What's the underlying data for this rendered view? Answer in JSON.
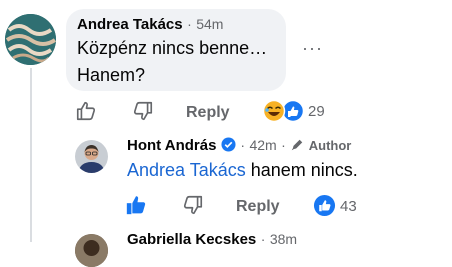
{
  "comment1": {
    "author": "Andrea Takács",
    "time": "54m",
    "separator": "·",
    "line1": "Közpénz nincs benne…",
    "line2": "Hanem?",
    "more": "···",
    "reply_label": "Reply",
    "reaction_count": "29"
  },
  "comment2": {
    "author": "Hont András",
    "separator": "·",
    "time": "42m",
    "author_badge": "Author",
    "mention": "Andrea Takács",
    "text": " hanem nincs.",
    "reply_label": "Reply",
    "reaction_count": "43"
  },
  "comment3": {
    "author": "Gabriella Kecskes",
    "time": "38m"
  },
  "colors": {
    "accent": "#1a66d2",
    "bubble": "#f0f2f5",
    "meta": "#65676b"
  }
}
